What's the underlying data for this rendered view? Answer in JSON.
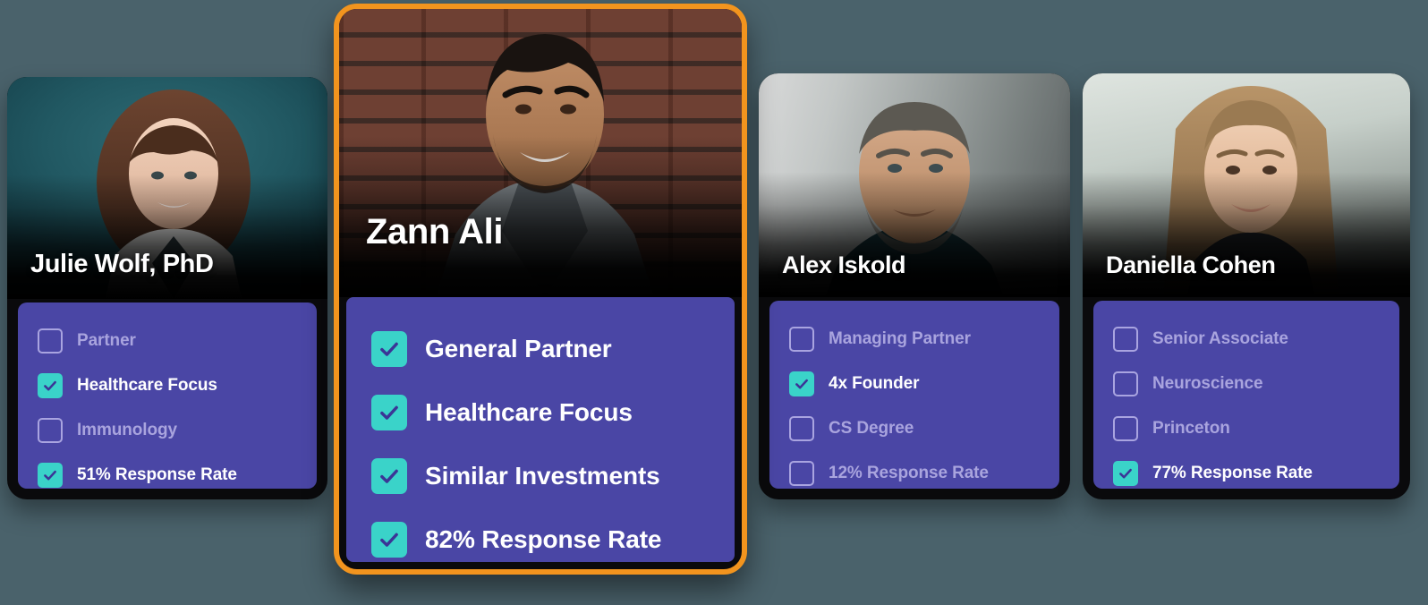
{
  "page": {
    "background_color": "#4a626b",
    "accent_color": "#f2941e",
    "panel_color": "#4a46a5",
    "checked_color": "#3ad3c9",
    "unchecked_border_color": "#a9a4e0",
    "unchecked_text_color": "#a9a4de",
    "checked_text_color": "#ffffff"
  },
  "cards": [
    {
      "id": "card-1",
      "name": "Julie Wolf, PhD",
      "featured": false,
      "checklist": [
        {
          "label": "Partner",
          "checked": false
        },
        {
          "label": "Healthcare Focus",
          "checked": true
        },
        {
          "label": "Immunology",
          "checked": false
        },
        {
          "label": "51% Response Rate",
          "checked": true
        }
      ]
    },
    {
      "id": "card-2",
      "name": "Zann Ali",
      "featured": true,
      "checklist": [
        {
          "label": "General Partner",
          "checked": true
        },
        {
          "label": "Healthcare Focus",
          "checked": true
        },
        {
          "label": "Similar Investments",
          "checked": true
        },
        {
          "label": "82% Response Rate",
          "checked": true
        }
      ]
    },
    {
      "id": "card-3",
      "name": "Alex Iskold",
      "featured": false,
      "checklist": [
        {
          "label": "Managing Partner",
          "checked": false
        },
        {
          "label": "4x Founder",
          "checked": true
        },
        {
          "label": "CS Degree",
          "checked": false
        },
        {
          "label": "12% Response Rate",
          "checked": false
        }
      ]
    },
    {
      "id": "card-4",
      "name": "Daniella Cohen",
      "featured": false,
      "checklist": [
        {
          "label": "Senior Associate",
          "checked": false
        },
        {
          "label": "Neuroscience",
          "checked": false
        },
        {
          "label": "Princeton",
          "checked": false
        },
        {
          "label": "77% Response Rate",
          "checked": true
        }
      ]
    }
  ]
}
